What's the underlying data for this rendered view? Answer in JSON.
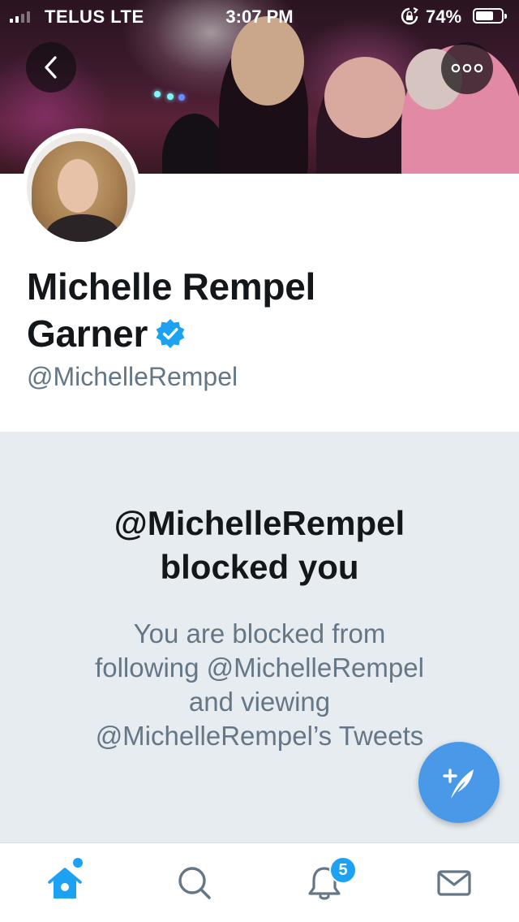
{
  "status_bar": {
    "carrier": "TELUS  LTE",
    "time": "3:07 PM",
    "battery_percent": "74%",
    "battery_level": 0.74
  },
  "header": {
    "back_icon": "chevron-left-icon",
    "more_icon": "more-dots-icon"
  },
  "profile": {
    "name": "Michelle Rempel Garner",
    "name_line1": "Michelle Rempel",
    "name_line2": "Garner",
    "verified_icon": "verified-badge-icon",
    "handle": "@MichelleRempel"
  },
  "blocked": {
    "title_line1": "@MichelleRempel",
    "title_line2": "blocked you",
    "description_line1": "You are blocked from",
    "description_line2": "following @MichelleRempel",
    "description_line3": "and viewing",
    "description_line4": "@MichelleRempel’s Tweets"
  },
  "compose": {
    "icon": "compose-tweet-icon"
  },
  "tab_bar": {
    "items": [
      {
        "name": "home",
        "icon": "home-icon",
        "active": true
      },
      {
        "name": "search",
        "icon": "search-icon",
        "active": false
      },
      {
        "name": "notifications",
        "icon": "bell-icon",
        "active": false,
        "badge": "5"
      },
      {
        "name": "messages",
        "icon": "envelope-icon",
        "active": false
      }
    ]
  },
  "colors": {
    "accent": "#1da1f2",
    "fab": "#4a99e9",
    "secondary_text": "#657786",
    "panel_bg": "#e6ecf0",
    "verified": "#1da1f2"
  }
}
